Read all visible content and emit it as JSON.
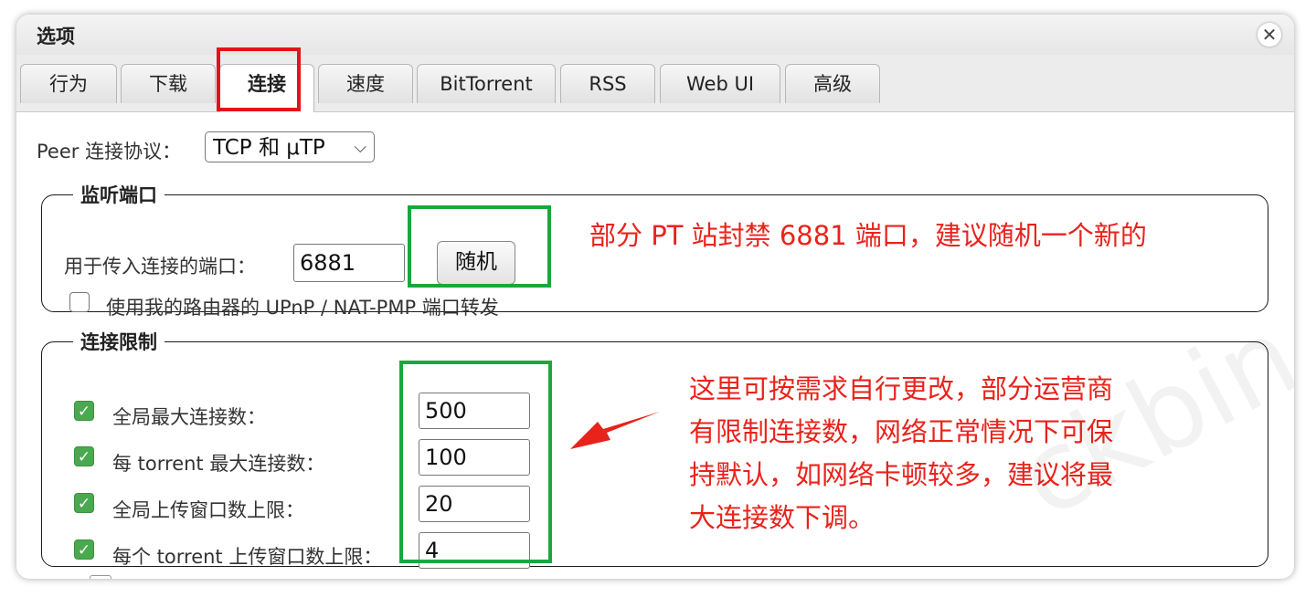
{
  "window": {
    "title": "选项",
    "close_glyph": "✕"
  },
  "tabs": [
    "行为",
    "下载",
    "连接",
    "速度",
    "BitTorrent",
    "RSS",
    "Web UI",
    "高级"
  ],
  "active_tab": "连接",
  "peer": {
    "label": "Peer 连接协议：",
    "value": "TCP 和 μTP",
    "arrow": "⌵"
  },
  "listen": {
    "legend": "监听端口",
    "port_label": "用于传入连接的端口：",
    "port_value": "6881",
    "random_button": "随机",
    "upnp_label": "使用我的路由器的 UPnP / NAT-PMP 端口转发",
    "upnp_checked": false
  },
  "limits": {
    "legend": "连接限制",
    "items": [
      {
        "label": "全局最大连接数：",
        "value": "500",
        "checked": true
      },
      {
        "label": "每 torrent 最大连接数：",
        "value": "100",
        "checked": true
      },
      {
        "label": "全局上传窗口数上限：",
        "value": "20",
        "checked": true
      },
      {
        "label": "每个 torrent 上传窗口数上限：",
        "value": "4",
        "checked": true
      }
    ]
  },
  "annotations": {
    "port_note": "部分 PT 站封禁 6881 端口，建议随机一个新的",
    "limit_note": [
      "这里可按需求自行更改，部分运营商",
      "有限制连接数，网络正常情况下可保",
      "持默认，如网络卡顿较多，建议将最",
      "大连接数下调。"
    ]
  },
  "watermark": "ckbin",
  "colors": {
    "highlight_red": "#e2141b",
    "highlight_green": "#1aa83c",
    "annotation_text": "#e8231c",
    "checkbox_green": "#4aa84e"
  }
}
